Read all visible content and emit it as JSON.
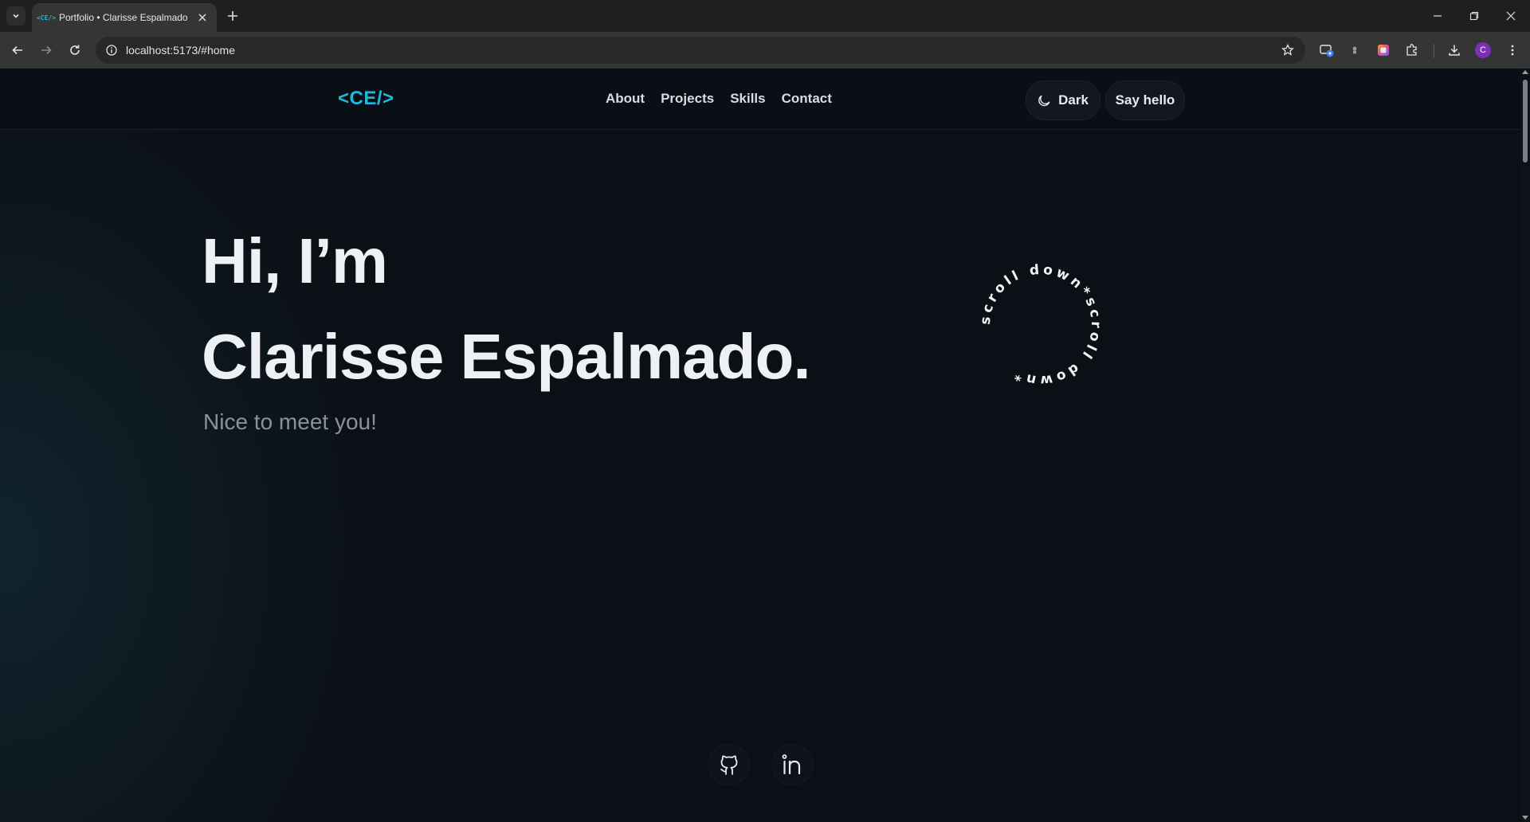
{
  "browser": {
    "tab_title": "Portfolio • Clarisse Espalmado",
    "tab_favicon_text": "<CE/>",
    "url": "localhost:5173/#home",
    "profile_initial": "C"
  },
  "header": {
    "logo": "<CE/>",
    "nav": [
      "About",
      "Projects",
      "Skills",
      "Contact"
    ],
    "theme_label": "Dark",
    "cta_label": "Say hello"
  },
  "hero": {
    "line1": "Hi, I’m",
    "line2": "Clarisse Espalmado.",
    "subtitle": "Nice to meet you!"
  },
  "scroll_badge": {
    "text": "scroll down*scroll down*"
  },
  "social": {
    "github_icon": "github-icon",
    "linkedin_icon": "linkedin-icon"
  },
  "colors": {
    "accent": "#22b7dc",
    "background": "#0b0f16"
  }
}
